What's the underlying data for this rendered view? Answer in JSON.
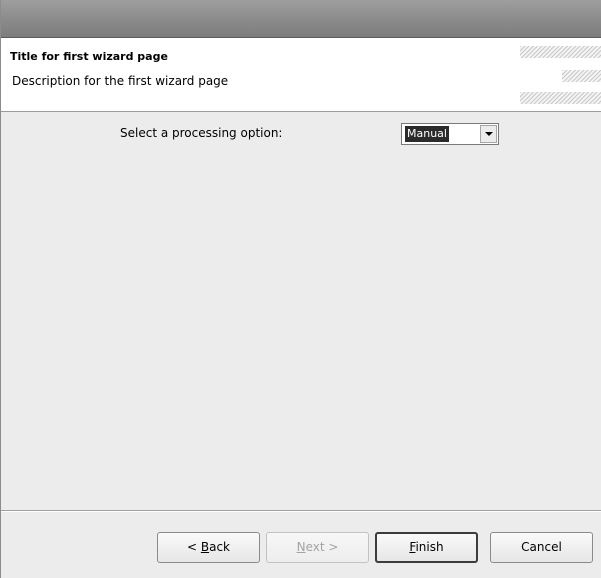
{
  "header": {
    "title": "Title for first wizard page",
    "description": "Description for the first wizard page"
  },
  "content": {
    "option_label": "Select a processing option:",
    "processing_option": {
      "selected": "Manual"
    }
  },
  "buttons": {
    "back": {
      "mnemonic": "B",
      "rest": "ack",
      "prefix": "< "
    },
    "next": {
      "mnemonic": "N",
      "rest": "ext >"
    },
    "finish": {
      "mnemonic": "F",
      "rest": "inish"
    },
    "cancel": {
      "label": "Cancel"
    }
  }
}
